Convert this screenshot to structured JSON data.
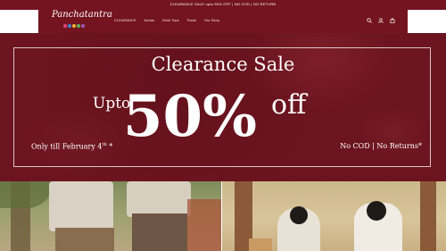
{
  "announcement": {
    "text": "CLEARANCE SALE upto 50% OFF | NO COD | NO RETURN"
  },
  "brand": {
    "logo_text": "Panchatantra",
    "dot_colors": [
      "#e0487b",
      "#3c8bd6",
      "#f2b435",
      "#5bb35d",
      "#9b59b6"
    ]
  },
  "nav": {
    "items": [
      "CLEARANCE",
      "Kurtas",
      "Work Tops",
      "Pants",
      "Our Story"
    ]
  },
  "header_icons": [
    "search-icon",
    "account-icon",
    "cart-icon"
  ],
  "hero": {
    "title": "Clearance Sale",
    "upto": "Upto",
    "percent": "50%",
    "off": "off",
    "till": "Only till February 4",
    "till_suffix": "th",
    "till_mark": " *",
    "returns": "No COD | No Returns*"
  },
  "colors": {
    "brand": "#741420",
    "hero_bg": "#6c1420",
    "text_light": "#ffffff"
  }
}
